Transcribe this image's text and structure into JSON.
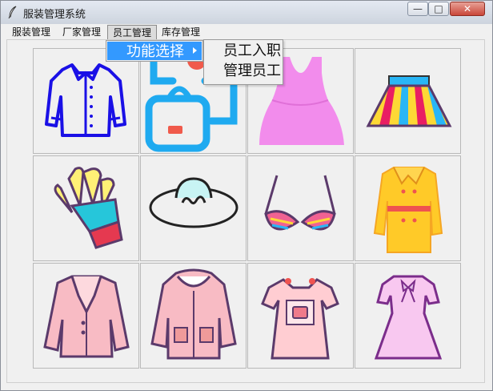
{
  "window": {
    "title": "服装管理系统",
    "min_label": "—",
    "max_label": "□",
    "close_label": "✕"
  },
  "menubar": {
    "items": [
      {
        "label": "服装管理"
      },
      {
        "label": "厂家管理"
      },
      {
        "label": "员工管理",
        "active": true
      },
      {
        "label": "库存管理"
      }
    ]
  },
  "dropdown": {
    "label": "功能选择"
  },
  "submenu": {
    "items": [
      {
        "label": "员工入职"
      },
      {
        "label": "管理员工"
      }
    ]
  },
  "grid": {
    "cells": [
      {
        "name": "shirt-icon"
      },
      {
        "name": "handbag-icon"
      },
      {
        "name": "pink-dress-icon"
      },
      {
        "name": "striped-skirt-icon"
      },
      {
        "name": "glove-icon"
      },
      {
        "name": "sun-hat-icon"
      },
      {
        "name": "bikini-top-icon"
      },
      {
        "name": "trench-coat-icon"
      },
      {
        "name": "blazer-icon"
      },
      {
        "name": "hooded-jacket-icon"
      },
      {
        "name": "overall-dress-icon"
      },
      {
        "name": "bow-dress-icon"
      }
    ]
  },
  "colors": {
    "menu_highlight": "#3399ff",
    "close_button": "#c9473a"
  }
}
